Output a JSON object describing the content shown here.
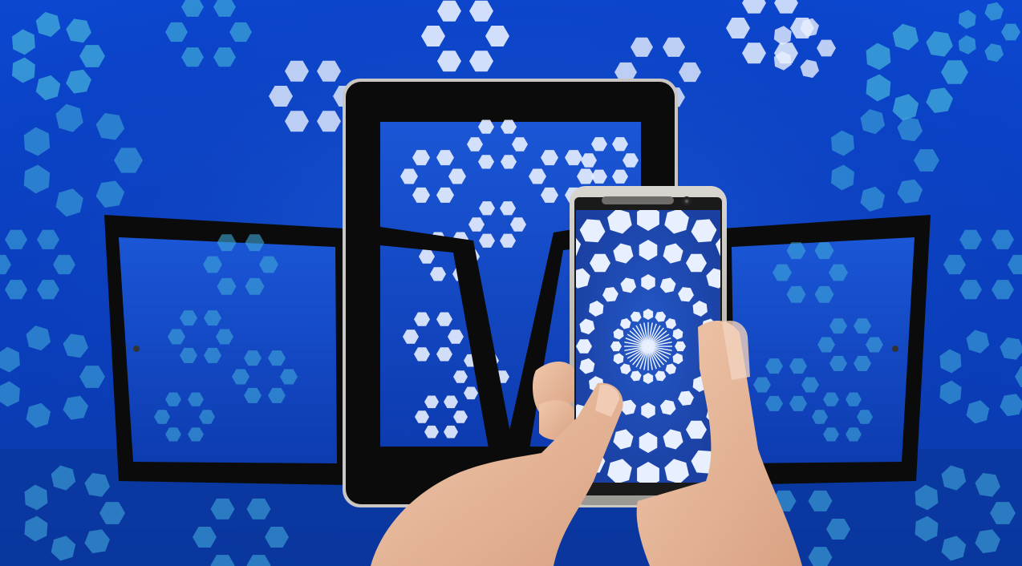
{
  "scene": {
    "description_icon": "devices-kaleidoscope-illustration",
    "colors": {
      "background_dark": "#072a9a",
      "background_mid": "#0b47d0",
      "background_light": "#2a6fe8",
      "pattern_teal": "#3fa8d8",
      "pattern_white": "#e8f0ff",
      "bezel": "#0b0b0b",
      "phone_silver": "#b8b4b0",
      "skin": "#e7b79a"
    },
    "devices": [
      {
        "kind": "tablet-left",
        "icon": "tablet-icon"
      },
      {
        "kind": "tablet-center",
        "icon": "tablet-icon"
      },
      {
        "kind": "tablet-right",
        "icon": "tablet-icon"
      },
      {
        "kind": "smartphone",
        "icon": "smartphone-icon"
      }
    ],
    "hands": [
      "left-hand",
      "right-hand"
    ]
  }
}
